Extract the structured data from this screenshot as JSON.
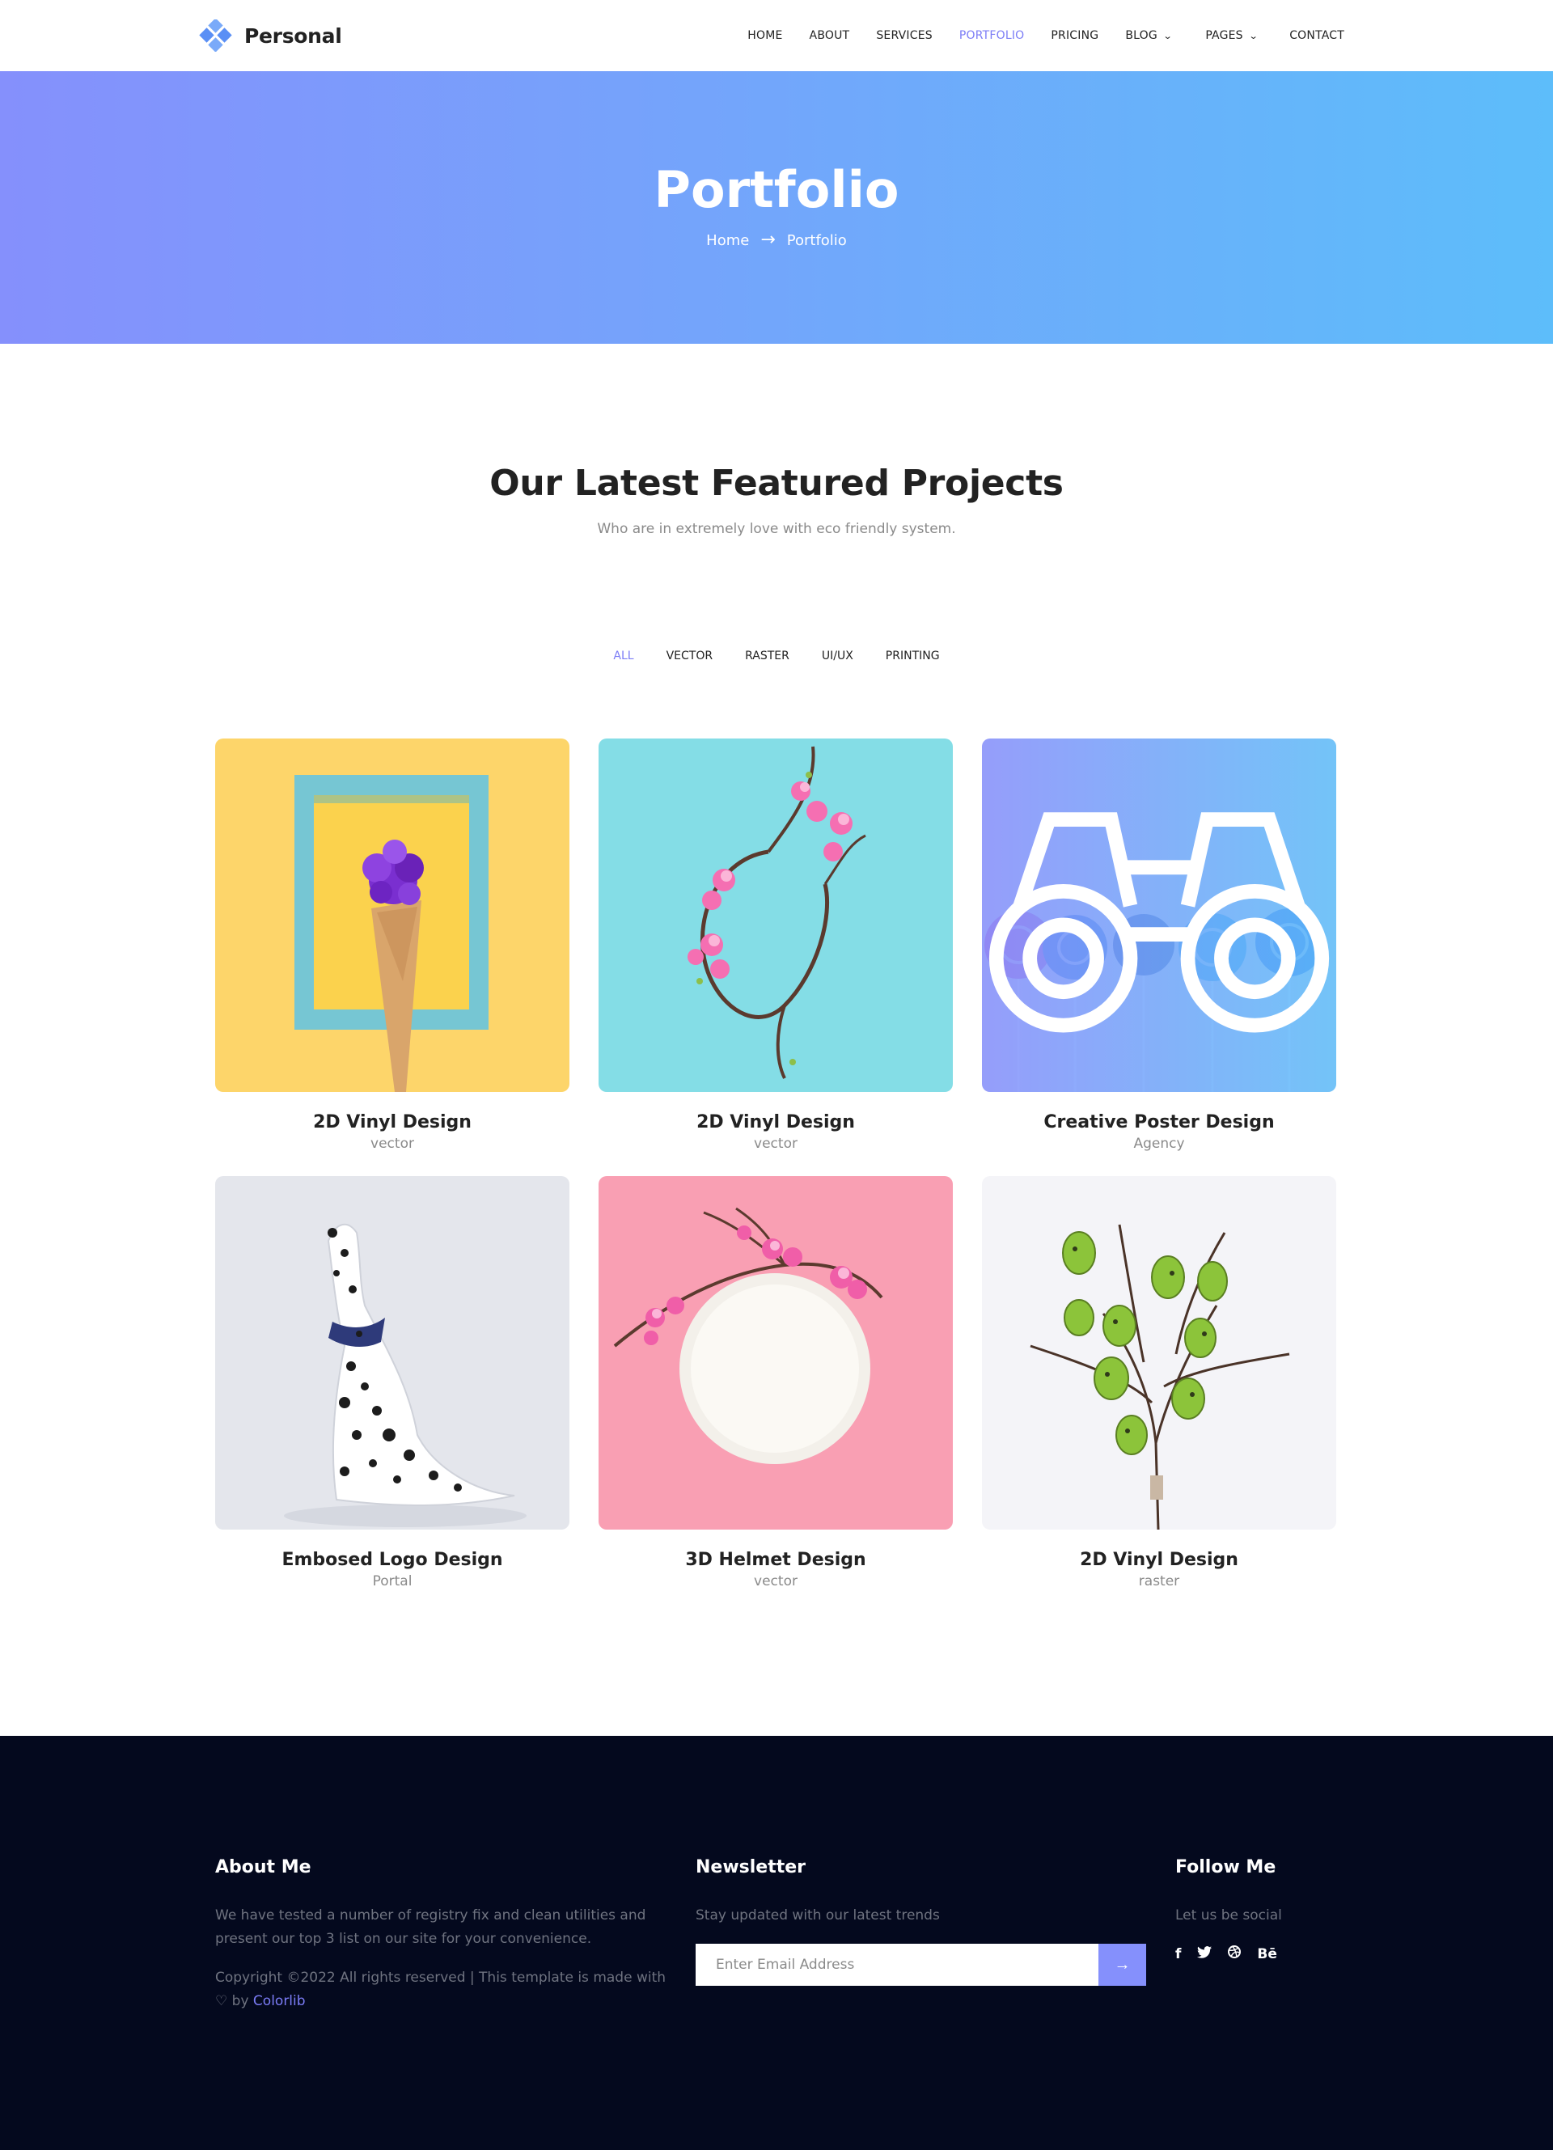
{
  "brand": {
    "name": "Personal",
    "logo_color": "#6a9cf8"
  },
  "nav": {
    "items": [
      {
        "label": "HOME",
        "active": false
      },
      {
        "label": "ABOUT",
        "active": false
      },
      {
        "label": "SERVICES",
        "active": false
      },
      {
        "label": "PORTFOLIO",
        "active": true
      },
      {
        "label": "PRICING",
        "active": false
      },
      {
        "label": "BLOG",
        "active": false,
        "dropdown": true
      },
      {
        "label": "PAGES",
        "active": false,
        "dropdown": true
      },
      {
        "label": "CONTACT",
        "active": false
      }
    ],
    "active_color": "#7b7cf6"
  },
  "banner": {
    "title": "Portfolio",
    "breadcrumb": [
      "Home",
      "Portfolio"
    ],
    "gradient": [
      "#8590fc",
      "#5dbdfa"
    ]
  },
  "section": {
    "title": "Our Latest Featured Projects",
    "subtitle": "Who are in extremely love with eco friendly system."
  },
  "filters": {
    "items": [
      "ALL",
      "VECTOR",
      "RASTER",
      "UI/UX",
      "PRINTING"
    ],
    "active": "ALL"
  },
  "projects": [
    {
      "title": "2D Vinyl Design",
      "category": "vector",
      "image": "ice-cream-cone-in-frame"
    },
    {
      "title": "2D Vinyl Design",
      "category": "vector",
      "image": "flower-branch-wreath"
    },
    {
      "title": "Creative Poster Design",
      "category": "Agency",
      "image": "lollipops-with-overlay"
    },
    {
      "title": "Embosed Logo Design",
      "category": "Portal",
      "image": "dalmatian-dog"
    },
    {
      "title": "3D Helmet Design",
      "category": "vector",
      "image": "plate-with-blossoms"
    },
    {
      "title": "2D Vinyl Design",
      "category": "raster",
      "image": "branch-with-eggs"
    }
  ],
  "footer": {
    "about": {
      "title": "About Me",
      "text": "We have tested a number of registry fix and clean utilities and present our top 3 list on our site for your convenience.",
      "copyright_prefix": "Copyright ©2022 All rights reserved | This template is made with",
      "copyright_by": "by",
      "copyright_link": "Colorlib"
    },
    "newsletter": {
      "title": "Newsletter",
      "text": "Stay updated with our latest trends",
      "placeholder": "Enter Email Address",
      "button_icon": "arrow-right-icon"
    },
    "follow": {
      "title": "Follow Me",
      "text": "Let us be social",
      "icons": [
        "facebook-icon",
        "twitter-icon",
        "dribbble-icon",
        "behance-icon"
      ]
    },
    "background": "#04091e"
  }
}
